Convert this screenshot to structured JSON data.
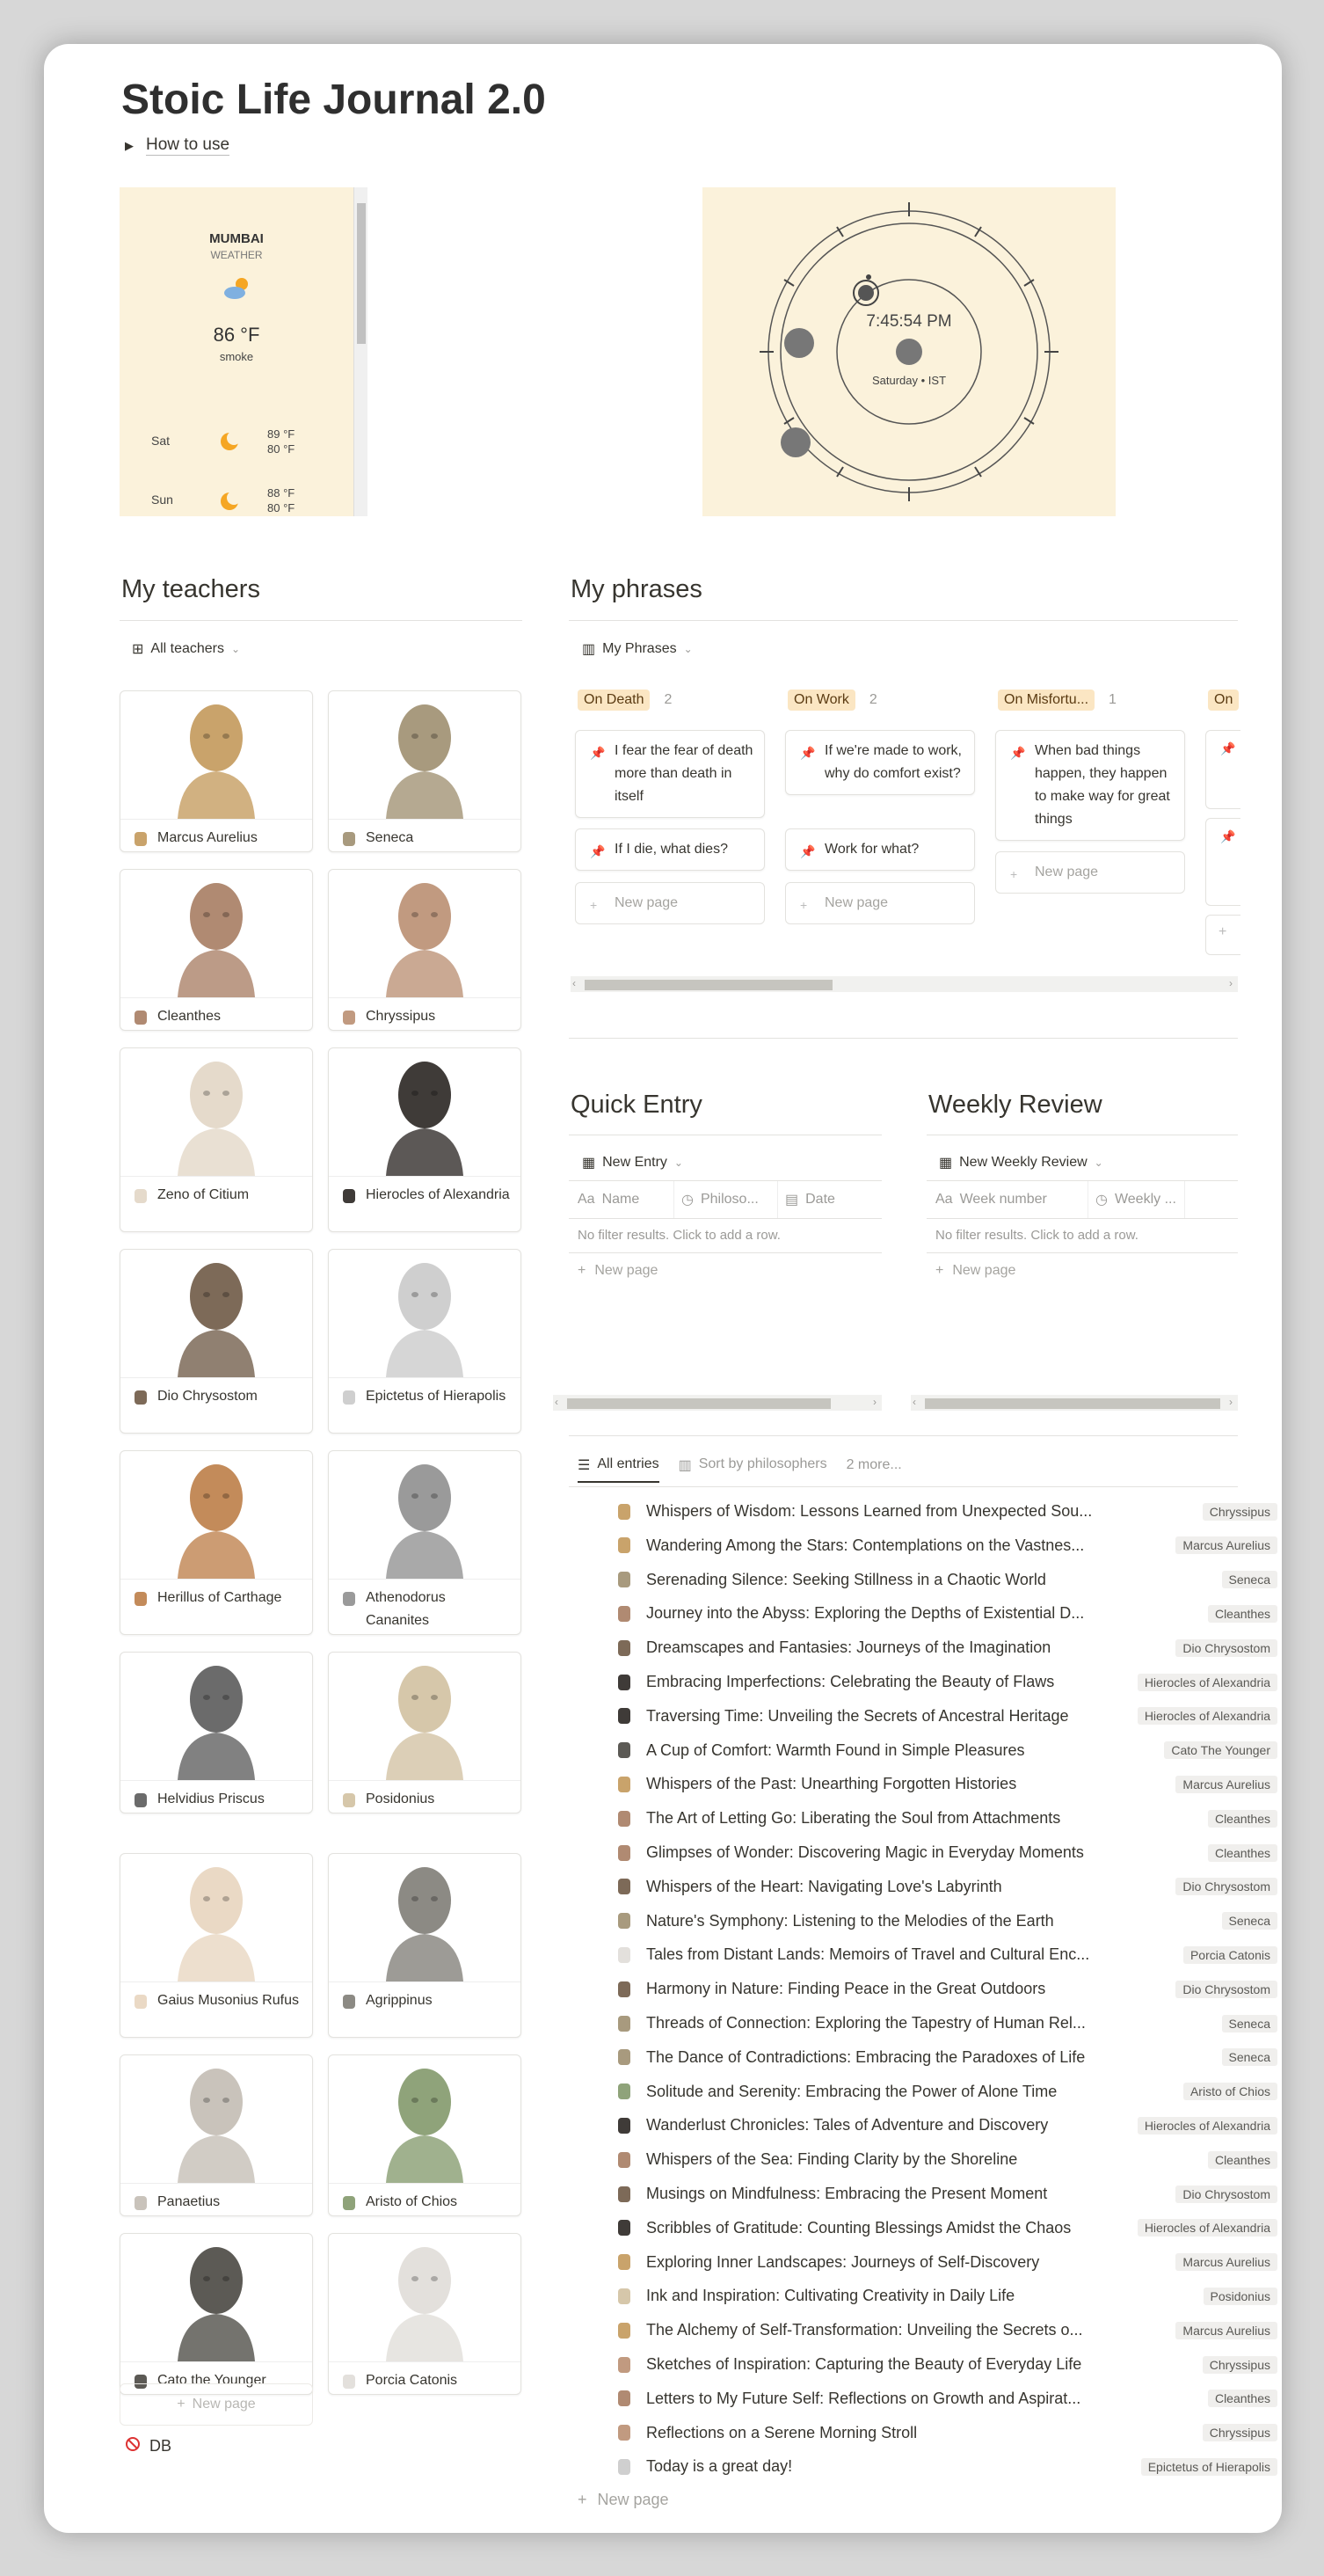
{
  "page": {
    "title": "Stoic Life Journal 2.0",
    "how_to_use": "How to use"
  },
  "weather": {
    "city": "MUMBAI",
    "label": "WEATHER",
    "temp": "86 °F",
    "desc": "smoke",
    "forecast": [
      {
        "day": "Sat",
        "high": "89 °F",
        "low": "80 °F"
      },
      {
        "day": "Sun",
        "high": "88 °F",
        "low": "80 °F"
      }
    ]
  },
  "clock": {
    "time": "7:45:54 PM",
    "date": "Saturday • IST"
  },
  "teachers": {
    "heading": "My teachers",
    "view": "All teachers",
    "new_page": "New page",
    "db_link": "DB",
    "items": [
      {
        "name": "Marcus Aurelius",
        "color": "#c9a36b"
      },
      {
        "name": "Seneca",
        "color": "#a89a7e"
      },
      {
        "name": "Cleanthes",
        "color": "#b08a72"
      },
      {
        "name": "Chryssipus",
        "color": "#c19a80"
      },
      {
        "name": "Zeno of Citium",
        "color": "#e5dacb"
      },
      {
        "name": "Hierocles of Alexandria",
        "color": "#3f3b38"
      },
      {
        "name": "Dio Chrysostom",
        "color": "#7d6a58"
      },
      {
        "name": "Epictetus of Hierapolis",
        "color": "#cfcfcf"
      },
      {
        "name": "Herillus of Carthage",
        "color": "#c38b5a"
      },
      {
        "name": "Athenodorus Cananites",
        "color": "#9a9a9a"
      },
      {
        "name": "Helvidius Priscus",
        "color": "#6b6b6b"
      },
      {
        "name": "Posidonius",
        "color": "#d6c7aa"
      },
      {
        "name": "Gaius Musonius Rufus",
        "color": "#ead9c5"
      },
      {
        "name": "Agrippinus",
        "color": "#8c8a84"
      },
      {
        "name": "Panaetius",
        "color": "#c9c3bb"
      },
      {
        "name": "Aristo of Chios",
        "color": "#8fa37a"
      },
      {
        "name": "Cato the Younger",
        "color": "#5c5a55"
      },
      {
        "name": "Porcia Catonis",
        "color": "#e3e0dc"
      }
    ]
  },
  "phrases": {
    "heading": "My phrases",
    "view": "My Phrases",
    "columns": [
      {
        "label": "On Death",
        "count": "2",
        "cards": [
          "I fear the fear of death more than death in itself",
          "If I die, what dies?"
        ]
      },
      {
        "label": "On Work",
        "count": "2",
        "cards": [
          "If we're made to work, why do comfort exist?",
          "Work for what?"
        ]
      },
      {
        "label": "On Misfortu...",
        "count": "1",
        "cards": [
          "When bad things happen, they happen to make way for great things"
        ]
      },
      {
        "label": "On",
        "count": "",
        "cards": []
      }
    ],
    "new_page": "New page"
  },
  "quick_entry": {
    "heading": "Quick Entry",
    "view": "New Entry",
    "cols": [
      "Name",
      "Philoso...",
      "Date"
    ],
    "empty": "No filter results. Click to add a row.",
    "new_page": "New page"
  },
  "weekly_review": {
    "heading": "Weekly Review",
    "view": "New Weekly Review",
    "cols": [
      "Week number",
      "Weekly ..."
    ],
    "empty": "No filter results. Click to add a row.",
    "new_page": "New page"
  },
  "entries": {
    "tabs": [
      "All entries",
      "Sort by philosophers",
      "2 more..."
    ],
    "new_page": "New page",
    "rows": [
      {
        "title": "Whispers of Wisdom: Lessons Learned from Unexpected Sou...",
        "tag": "Chryssipus"
      },
      {
        "title": "Wandering Among the Stars: Contemplations on the Vastnes...",
        "tag": "Marcus Aurelius"
      },
      {
        "title": "Serenading Silence: Seeking Stillness in a Chaotic World",
        "tag": "Seneca"
      },
      {
        "title": "Journey into the Abyss: Exploring the Depths of Existential D...",
        "tag": "Cleanthes"
      },
      {
        "title": "Dreamscapes and Fantasies: Journeys of the Imagination",
        "tag": "Dio Chrysostom"
      },
      {
        "title": "Embracing Imperfections: Celebrating the Beauty of Flaws",
        "tag": "Hierocles of Alexandria"
      },
      {
        "title": "Traversing Time: Unveiling the Secrets of Ancestral Heritage",
        "tag": "Hierocles of Alexandria"
      },
      {
        "title": "A Cup of Comfort: Warmth Found in Simple Pleasures",
        "tag": "Cato The Younger"
      },
      {
        "title": "Whispers of the Past: Unearthing Forgotten Histories",
        "tag": "Marcus Aurelius"
      },
      {
        "title": "The Art of Letting Go: Liberating the Soul from Attachments",
        "tag": "Cleanthes"
      },
      {
        "title": "Glimpses of Wonder: Discovering Magic in Everyday Moments",
        "tag": "Cleanthes"
      },
      {
        "title": "Whispers of the Heart: Navigating Love's Labyrinth",
        "tag": "Dio Chrysostom"
      },
      {
        "title": "Nature's Symphony: Listening to the Melodies of the Earth",
        "tag": "Seneca"
      },
      {
        "title": "Tales from Distant Lands: Memoirs of Travel and Cultural Enc...",
        "tag": "Porcia Catonis"
      },
      {
        "title": "Harmony in Nature: Finding Peace in the Great Outdoors",
        "tag": "Dio Chrysostom"
      },
      {
        "title": "Threads of Connection: Exploring the Tapestry of Human Rel...",
        "tag": "Seneca"
      },
      {
        "title": "The Dance of Contradictions: Embracing the Paradoxes of Life",
        "tag": "Seneca"
      },
      {
        "title": "Solitude and Serenity: Embracing the Power of Alone Time",
        "tag": "Aristo of Chios"
      },
      {
        "title": "Wanderlust Chronicles: Tales of Adventure and Discovery",
        "tag": "Hierocles of Alexandria"
      },
      {
        "title": "Whispers of the Sea: Finding Clarity by the Shoreline",
        "tag": "Cleanthes"
      },
      {
        "title": "Musings on Mindfulness: Embracing the Present Moment",
        "tag": "Dio Chrysostom"
      },
      {
        "title": "Scribbles of Gratitude: Counting Blessings Amidst the Chaos",
        "tag": "Hierocles of Alexandria"
      },
      {
        "title": "Exploring Inner Landscapes: Journeys of Self-Discovery",
        "tag": "Marcus Aurelius"
      },
      {
        "title": "Ink and Inspiration: Cultivating Creativity in Daily Life",
        "tag": "Posidonius"
      },
      {
        "title": "The Alchemy of Self-Transformation: Unveiling the Secrets o...",
        "tag": "Marcus Aurelius"
      },
      {
        "title": "Sketches of Inspiration: Capturing the Beauty of Everyday Life",
        "tag": "Chryssipus"
      },
      {
        "title": "Letters to My Future Self: Reflections on Growth and Aspirat...",
        "tag": "Cleanthes"
      },
      {
        "title": "Reflections on a Serene Morning Stroll",
        "tag": "Chryssipus"
      },
      {
        "title": "Today is a great day!",
        "tag": "Epictetus of Hierapolis"
      }
    ]
  }
}
